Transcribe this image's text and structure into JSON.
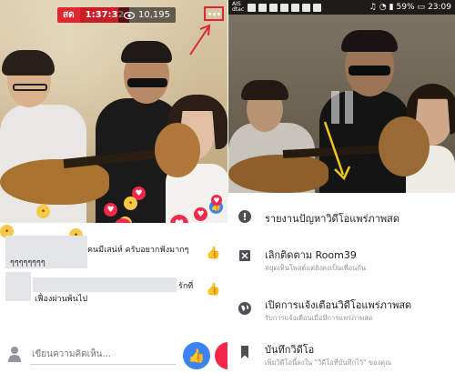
{
  "left": {
    "live_label": "สด",
    "live_time": "1:37:32",
    "viewer_count": "10,195",
    "comments": [
      {
        "text": "คนมีเสน่ห์ ครับอยากฟังมากๆ",
        "text2": "ๆๆๆๆๆๆๆๆ"
      },
      {
        "text": "รักที่",
        "text2": "เฟื่องผ่านพ้นไป"
      }
    ],
    "compose_placeholder": "เขียนความคิดเห็น..."
  },
  "right": {
    "status": {
      "carrier": "AIS dtac",
      "battery": "59%",
      "time": "23:09"
    },
    "menu": [
      {
        "icon": "alert-icon",
        "title": "รายงานปัญหาวิดีโอแพร่ภาพสด",
        "subtitle": ""
      },
      {
        "icon": "unfollow-icon",
        "title": "เลิกติดตาม Room39",
        "subtitle": "หยุดเห็นโพสต์แต่ยังคงเป็นเพื่อนกัน"
      },
      {
        "icon": "globe-icon",
        "title": "เปิดการแจ้งเตือนวิดีโอแพร่ภาพสด",
        "subtitle": "รับการแจ้งเตือนเมื่อมีการแพร่ภาพสด"
      },
      {
        "icon": "bookmark-icon",
        "title": "บันทึกวิดีโอ",
        "subtitle": "เพิ่มวิดีโอนี้ลงใน \"วิดีโอที่บันทึกไว้\" ของคุณ"
      }
    ]
  },
  "colors": {
    "live_red": "#e4262e",
    "fb_blue": "#3b82f6",
    "love_red": "#f0284a",
    "annotation_red": "#e0262e",
    "annotation_yellow": "#f5c518"
  }
}
